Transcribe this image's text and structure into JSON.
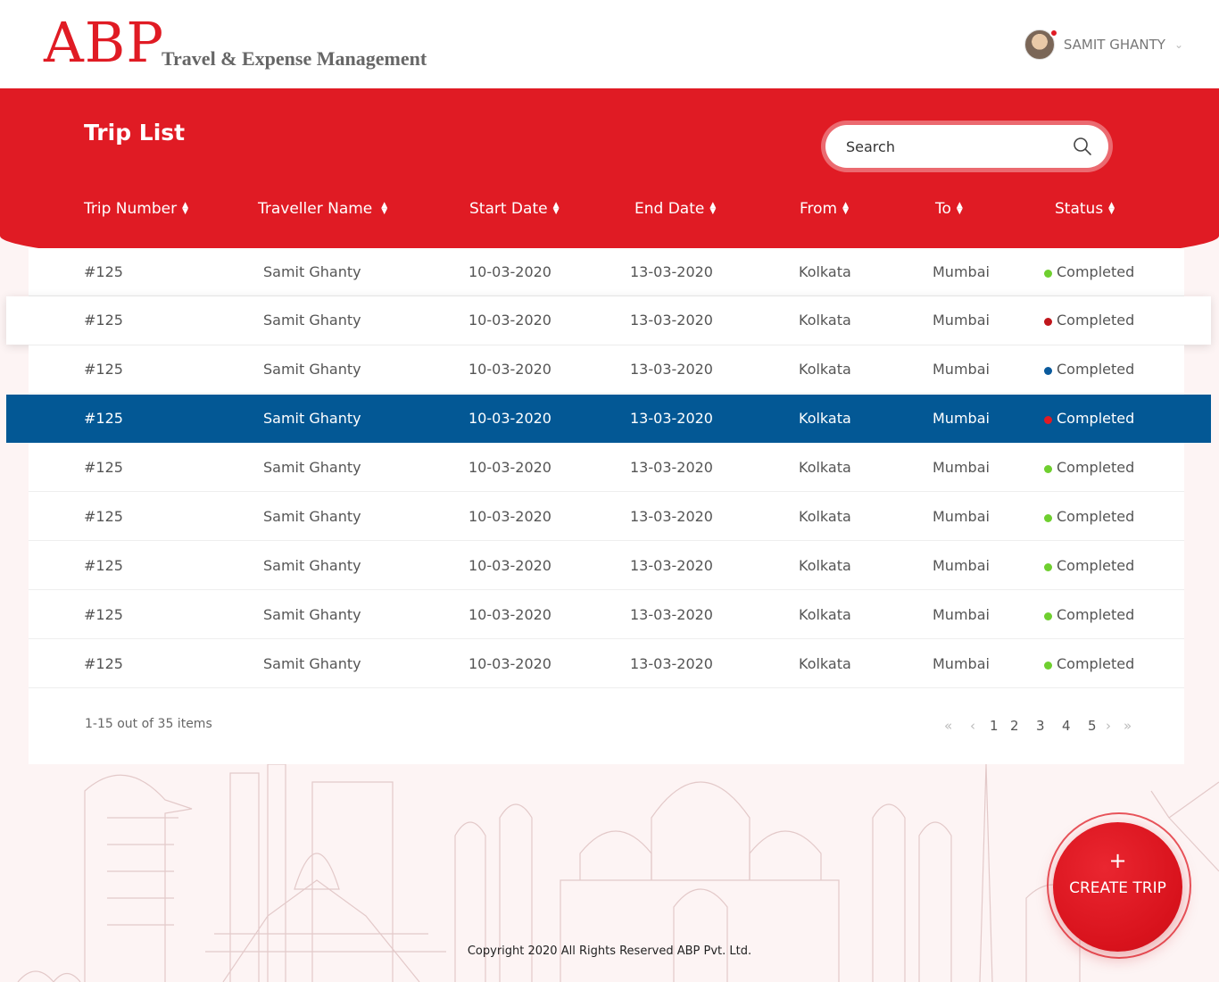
{
  "header": {
    "logo_text": "ABP",
    "logo_subtitle": "Travel & Expense Management",
    "user_name": "SAMIT GHANTY",
    "user_menu_icon": "chevron-down-icon"
  },
  "page": {
    "title": "Trip List",
    "search_placeholder": "Search",
    "search_icon": "search-icon"
  },
  "columns": [
    {
      "label": "Trip Number"
    },
    {
      "label": "Traveller Name"
    },
    {
      "label": "Start Date"
    },
    {
      "label": "End Date"
    },
    {
      "label": "From"
    },
    {
      "label": "To"
    },
    {
      "label": "Status"
    }
  ],
  "rows": [
    {
      "trip": "#125",
      "traveller": "Samit Ghanty",
      "start": "10-03-2020",
      "end": "13-03-2020",
      "from": "Kolkata",
      "to": "Mumbai",
      "status": "Completed",
      "status_color": "#6fcf2f",
      "state": "normal"
    },
    {
      "trip": "#125",
      "traveller": "Samit Ghanty",
      "start": "10-03-2020",
      "end": "13-03-2020",
      "from": "Kolkata",
      "to": "Mumbai",
      "status": "Completed",
      "status_color": "#c0161c",
      "state": "hover"
    },
    {
      "trip": "#125",
      "traveller": "Samit Ghanty",
      "start": "10-03-2020",
      "end": "13-03-2020",
      "from": "Kolkata",
      "to": "Mumbai",
      "status": "Completed",
      "status_color": "#0a5a9c",
      "state": "normal"
    },
    {
      "trip": "#125",
      "traveller": "Samit Ghanty",
      "start": "10-03-2020",
      "end": "13-03-2020",
      "from": "Kolkata",
      "to": "Mumbai",
      "status": "Completed",
      "status_color": "#e01b24",
      "state": "selected"
    },
    {
      "trip": "#125",
      "traveller": "Samit Ghanty",
      "start": "10-03-2020",
      "end": "13-03-2020",
      "from": "Kolkata",
      "to": "Mumbai",
      "status": "Completed",
      "status_color": "#6fcf2f",
      "state": "normal"
    },
    {
      "trip": "#125",
      "traveller": "Samit Ghanty",
      "start": "10-03-2020",
      "end": "13-03-2020",
      "from": "Kolkata",
      "to": "Mumbai",
      "status": "Completed",
      "status_color": "#6fcf2f",
      "state": "normal"
    },
    {
      "trip": "#125",
      "traveller": "Samit Ghanty",
      "start": "10-03-2020",
      "end": "13-03-2020",
      "from": "Kolkata",
      "to": "Mumbai",
      "status": "Completed",
      "status_color": "#6fcf2f",
      "state": "normal"
    },
    {
      "trip": "#125",
      "traveller": "Samit Ghanty",
      "start": "10-03-2020",
      "end": "13-03-2020",
      "from": "Kolkata",
      "to": "Mumbai",
      "status": "Completed",
      "status_color": "#6fcf2f",
      "state": "normal"
    },
    {
      "trip": "#125",
      "traveller": "Samit Ghanty",
      "start": "10-03-2020",
      "end": "13-03-2020",
      "from": "Kolkata",
      "to": "Mumbai",
      "status": "Completed",
      "status_color": "#6fcf2f",
      "state": "normal"
    }
  ],
  "pagination": {
    "summary": "1-15 out of 35 items",
    "pages": [
      "1",
      "2",
      "3",
      "4",
      "5"
    ],
    "first_icon": "double-chevron-left-icon",
    "prev_icon": "chevron-left-icon",
    "next_icon": "chevron-right-icon",
    "last_icon": "double-chevron-right-icon"
  },
  "fab": {
    "plus": "+",
    "label": "CREATE TRIP"
  },
  "footer": {
    "copyright": "Copyright 2020 All Rights Reserved ABP Pvt. Ltd."
  },
  "colors": {
    "brand_red": "#e01b24",
    "selected_row": "#035895"
  }
}
